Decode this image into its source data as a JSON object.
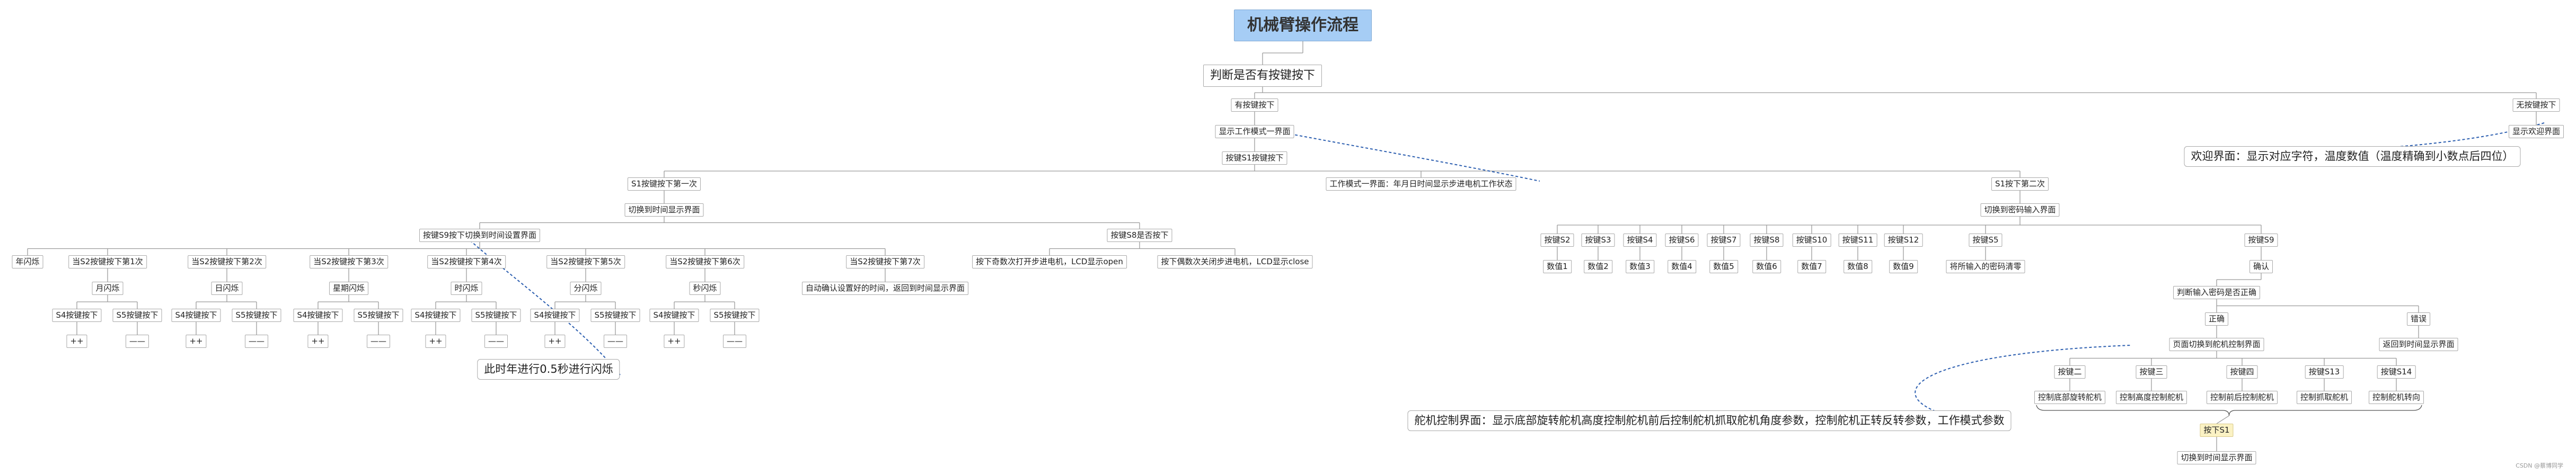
{
  "root": {
    "label": "机械臂操作流程"
  },
  "main": {
    "label": "判断是否有按键按下"
  },
  "no_key": {
    "label": "无按键按下",
    "child": "显示欢迎界面",
    "note": "欢迎界面：显示对应字符，温度数值（温度精确到小数点后四位）"
  },
  "has_key": {
    "label": "有按键按下",
    "show_work": "显示工作模式一界面",
    "s1_pressed": "按键S1按键按下",
    "work_mode_note": "工作模式一界面：年月日时间显示步进电机工作状态"
  },
  "s1_first": {
    "label": "S1按键按下第一次",
    "switch": "切换到时间显示界面",
    "s9": {
      "label": "按键S9按下切换到时间设置界面",
      "groups": [
        {
          "label": "年闪烁",
          "sub": "",
          "s4": "",
          "s5": "",
          "r4": "",
          "r5": ""
        },
        {
          "label": "当S2按键按下第1次",
          "sub": "月闪烁",
          "s4": "S4按键按下",
          "s5": "S5按键按下",
          "r4": "++",
          "r5": "——"
        },
        {
          "label": "当S2按键按下第2次",
          "sub": "日闪烁",
          "s4": "S4按键按下",
          "s5": "S5按键按下",
          "r4": "++",
          "r5": "——"
        },
        {
          "label": "当S2按键按下第3次",
          "sub": "星期闪烁",
          "s4": "S4按键按下",
          "s5": "S5按键按下",
          "r4": "++",
          "r5": "——"
        },
        {
          "label": "当S2按键按下第4次",
          "sub": "时闪烁",
          "s4": "S4按键按下",
          "s5": "S5按键按下",
          "r4": "++",
          "r5": "——"
        },
        {
          "label": "当S2按键按下第5次",
          "sub": "分闪烁",
          "s4": "S4按键按下",
          "s5": "S5按键按下",
          "r4": "++",
          "r5": "——"
        },
        {
          "label": "当S2按键按下第6次",
          "sub": "秒闪烁",
          "s4": "S4按键按下",
          "s5": "S5按键按下",
          "r4": "++",
          "r5": "——"
        },
        {
          "label": "当S2按键按下第7次",
          "sub": "自动确认设置好的时间，返回到时间显示界面",
          "s4": "",
          "s5": "",
          "r4": "",
          "r5": ""
        }
      ],
      "note": "此时年进行0.5秒进行闪烁"
    },
    "s8": {
      "label": "按键S8是否按下",
      "odd": "按下奇数次打开步进电机，LCD显示open",
      "even": "按下偶数次关闭步进电机，LCD显示close"
    }
  },
  "s1_second": {
    "label": "S1按下第二次",
    "switch": "切换到密码输入界面",
    "keys": [
      {
        "key": "按键S2",
        "digit": "数值1"
      },
      {
        "key": "按键S3",
        "digit": "数值2"
      },
      {
        "key": "按键S4",
        "digit": "数值3"
      },
      {
        "key": "按键S6",
        "digit": "数值4"
      },
      {
        "key": "按键S7",
        "digit": "数值5"
      },
      {
        "key": "按键S8",
        "digit": "数值6"
      },
      {
        "key": "按键S10",
        "digit": "数值7"
      },
      {
        "key": "按键S11",
        "digit": "数值8"
      },
      {
        "key": "按键S12",
        "digit": "数值9"
      }
    ],
    "s5": {
      "label": "按键S5",
      "child": "将所输入的密码清零"
    },
    "s9": {
      "label": "按键S9",
      "confirm": "确认",
      "judge": "判断输入密码是否正确",
      "correct": "正确",
      "wrong": "错误",
      "wrong_child": "返回到时间显示界面",
      "switch_page": "页面切换到舵机控制界面",
      "servo_keys": [
        {
          "key": "按键二",
          "action": "控制底部旋转舵机"
        },
        {
          "key": "按键三",
          "action": "控制高度控制舵机"
        },
        {
          "key": "按键四",
          "action": "控制前后控制舵机"
        },
        {
          "key": "按键S13",
          "action": "控制抓取舵机"
        },
        {
          "key": "按键S14",
          "action": "控制舵机转向"
        }
      ],
      "press_s1": "按下S1",
      "return_time": "切换到时间显示界面",
      "servo_note": "舵机控制界面：显示底部旋转舵机高度控制舵机前后控制舵机抓取舵机角度参数，控制舵机正转反转参数，工作模式参数"
    }
  },
  "watermark": "CSDN @蔡博同学"
}
